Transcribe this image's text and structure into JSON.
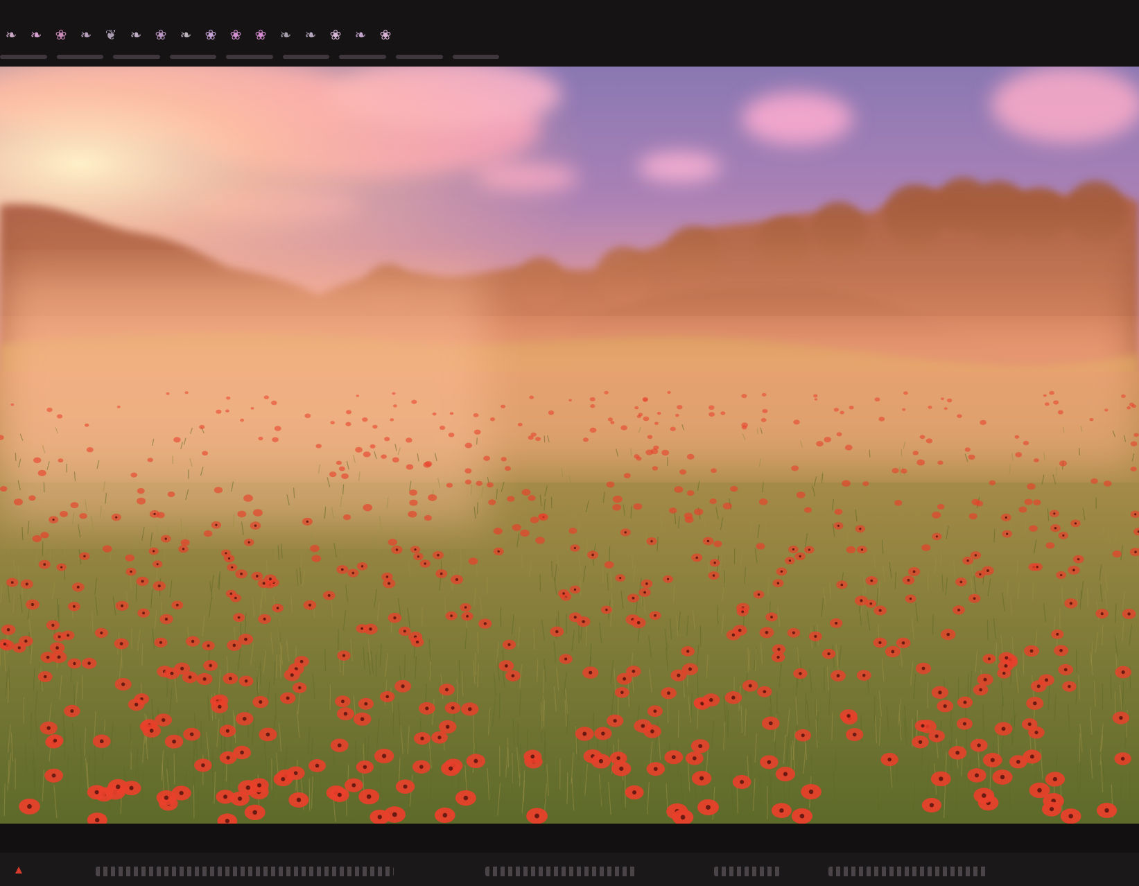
{
  "top_strip": {
    "thumbnails": [
      {
        "icon": "bird-icon",
        "color": "#c9a9c6"
      },
      {
        "icon": "bird-icon",
        "color": "#d9a3d3"
      },
      {
        "icon": "flower-icon",
        "color": "#c98ab8"
      },
      {
        "icon": "bird-icon",
        "color": "#b9a2bf"
      },
      {
        "icon": "leaf-icon",
        "color": "#a99bb0"
      },
      {
        "icon": "bird-icon",
        "color": "#c2b0c6"
      },
      {
        "icon": "flower-icon",
        "color": "#b996c1"
      },
      {
        "icon": "bird-icon",
        "color": "#bfb6c0"
      },
      {
        "icon": "flower-icon",
        "color": "#c4a2d6"
      },
      {
        "icon": "flower-icon",
        "color": "#cf8fcf"
      },
      {
        "icon": "flower-icon",
        "color": "#d48bcf"
      },
      {
        "icon": "bird-icon",
        "color": "#a7a1ad"
      },
      {
        "icon": "bird-icon",
        "color": "#b7aac1"
      },
      {
        "icon": "flower-icon",
        "color": "#d6b7d6"
      },
      {
        "icon": "bird-icon",
        "color": "#c5a7d0"
      },
      {
        "icon": "flower-icon",
        "color": "#d8b3d6"
      }
    ]
  },
  "scene": {
    "subject": "poppy-meadow-at-sunset",
    "colors": {
      "sky_top": "#8c7ab0",
      "sky_mid": "#c487b4",
      "sky_glow": "#ffd4a8",
      "clouds": "#f2a2c4",
      "trees": "#a0583a",
      "haze": "#f5a070",
      "grass": "#7d7a36",
      "grass_dark": "#4f5a22",
      "poppy": "#e8402a"
    }
  }
}
